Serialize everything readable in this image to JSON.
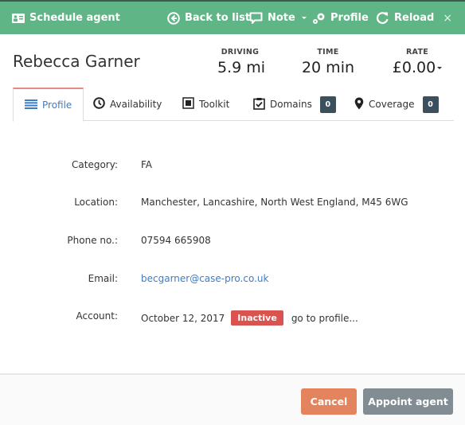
{
  "header": {
    "schedule_label": "Schedule agent",
    "back_label": "Back to list",
    "note_label": "Note",
    "profile_label": "Profile",
    "reload_label": "Reload",
    "close_glyph": "×",
    "bg_color": "#5fb585"
  },
  "agent": {
    "name": "Rebecca Garner"
  },
  "stats": {
    "driving": {
      "label": "DRIVING",
      "value": "5.9 mi"
    },
    "time": {
      "label": "TIME",
      "value": "20 min"
    },
    "rate": {
      "label": "RATE",
      "value": "£0.00"
    }
  },
  "tabs": [
    {
      "label": "Profile",
      "icon": "list-icon",
      "active": true
    },
    {
      "label": "Availability",
      "icon": "clock-icon"
    },
    {
      "label": "Toolkit",
      "icon": "square-icon"
    },
    {
      "label": "Domains",
      "icon": "clipboard-check-icon",
      "badge": "0"
    },
    {
      "label": "Coverage",
      "icon": "map-marker-icon",
      "badge": "0"
    }
  ],
  "profile": {
    "category": {
      "label": "Category:",
      "value": "FA"
    },
    "location": {
      "label": "Location:",
      "value": "Manchester, Lancashire, North West England, M45 6WG"
    },
    "phone": {
      "label": "Phone no.:",
      "value": "07594 665908"
    },
    "email": {
      "label": "Email:",
      "value": "becgarner@case-pro.co.uk"
    },
    "account": {
      "label": "Account:",
      "date": "October 12, 2017",
      "status": "Inactive",
      "link": "go to profile..."
    }
  },
  "footer": {
    "cancel_label": "Cancel",
    "appoint_label": "Appoint agent"
  }
}
